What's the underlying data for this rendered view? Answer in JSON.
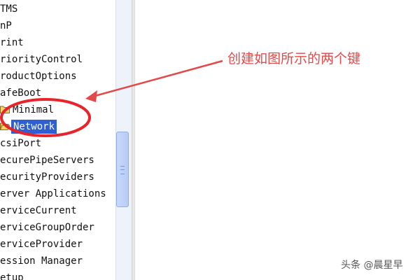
{
  "tree": {
    "items": [
      {
        "label": "TMS"
      },
      {
        "label": "nP"
      },
      {
        "label": "rint"
      },
      {
        "label": "riorityControl"
      },
      {
        "label": "roductOptions"
      },
      {
        "label": "afeBoot"
      },
      {
        "label": "Minimal"
      },
      {
        "label": "Network"
      },
      {
        "label": "csiPort"
      },
      {
        "label": "ecurePipeServers"
      },
      {
        "label": "ecurityProviders"
      },
      {
        "label": "erver Applications"
      },
      {
        "label": "erviceCurrent"
      },
      {
        "label": "erviceGroupOrder"
      },
      {
        "label": "erviceProvider"
      },
      {
        "label": "ession Manager"
      },
      {
        "label": "etup"
      }
    ],
    "selected": "Network"
  },
  "annotation": {
    "text": "创建如图所示的两个键",
    "color": "#e24a4a"
  },
  "watermark": {
    "text": "头条 @晨星早"
  },
  "colors": {
    "selection": "#2f5fd0",
    "folder": "#f3d36b",
    "annotation": "#e24a4a"
  }
}
